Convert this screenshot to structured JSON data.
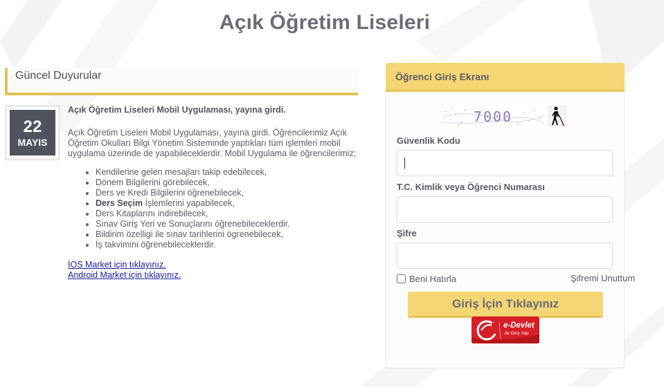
{
  "header": {
    "title": "Açık Öğretim Liseleri"
  },
  "announcements": {
    "section_title": "Güncel Duyurular",
    "date": {
      "day": "22",
      "month": "MAYIS"
    },
    "item": {
      "title": "Açık Öğretim Liseleri Mobil Uygulaması, yayına girdi.",
      "intro": "Açık Öğretim Liseleri Mobil Uygulaması, yayına girdi. Öğrencilerimiz Açık Öğretim Okulları Bilgi Yönetim Sisteminde yaptıkları tüm işlemleri mobil uygulama üzerinde de yapabileceklerdir. Mobil Uygulama ile öğrencilerimiz;",
      "list": [
        "Kendilerine gelen mesajları takip edebilecek,",
        "Dönem Bilgilerini görebilecek,",
        "Ders ve Kredi Bilgilerini öğrenebilecek,",
        "İşlemlerini yapabilecek,",
        "Ders Kitaplarını indirebilecek,",
        "Sınav Giriş Yeri ve Sonuçlarını öğrenebileceklerdir.",
        "Bildirim özelligi ile sınav tarihlerini ögrenebilecek,",
        "İş takvimini öğrenebileceklerdir."
      ],
      "list_bold_prefix": "Ders Seçim",
      "ios_link": "İOS Market için tıklayınız.",
      "android_link": "Android Market için tıklayınız."
    }
  },
  "login": {
    "panel_title": "Öğrenci Giriş Ekranı",
    "captcha_text": "7000",
    "security_code_label": "Güvenlik Kodu",
    "security_code_value": "",
    "id_label": "T.C. Kimlik veya Öğrenci Numarası",
    "id_value": "",
    "password_label": "Şifre",
    "password_value": "",
    "remember_label": "Beni Hatırla",
    "remember_checked": false,
    "forgot_label": "Şifremi Unuttum",
    "submit_label": "Giriş İçin Tıklayınız",
    "edevlet_name": "e-Devlet",
    "edevlet_sub": "ile Giriş Yap"
  },
  "colors": {
    "accent_yellow": "#f4d774",
    "accent_border": "#e2c25a",
    "date_box_bg": "#50535d",
    "edevlet_red": "#d61f26",
    "link_blue": "#1a1aa6"
  },
  "icons": {
    "accessibility": "accessibility-blind-person-icon",
    "edevlet": "edevlet-logo-icon"
  }
}
